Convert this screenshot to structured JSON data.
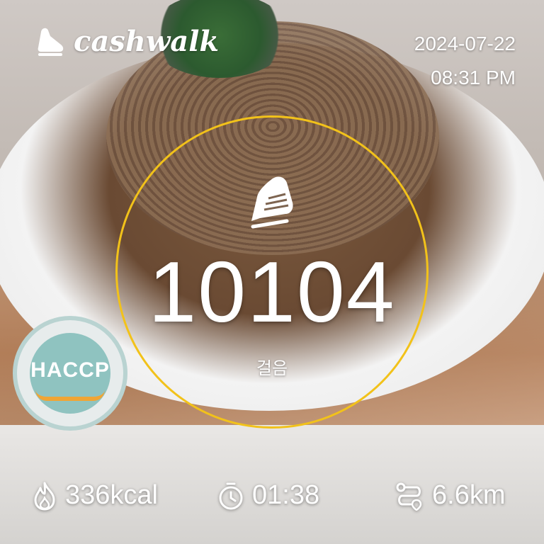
{
  "brand": {
    "name": "cashwalk",
    "logo_icon": "shoe-icon"
  },
  "datetime": {
    "date": "2024-07-22",
    "time": "08:31 PM"
  },
  "steps": {
    "count": "10104",
    "label": "걸음",
    "icon": "shoe-icon"
  },
  "stats": {
    "calories": {
      "icon": "flame-icon",
      "value": "336kcal"
    },
    "time": {
      "icon": "stopwatch-icon",
      "value": "01:38"
    },
    "distance": {
      "icon": "route-icon",
      "value": "6.6km"
    }
  },
  "colors": {
    "ring": "#f2c21a",
    "text": "#ffffff"
  }
}
